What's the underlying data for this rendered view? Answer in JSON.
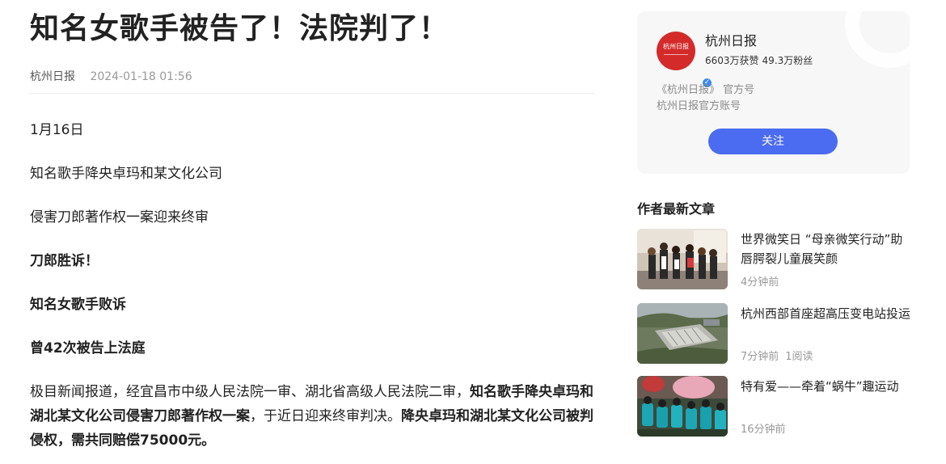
{
  "article": {
    "title": "知名女歌手被告了！法院判了！",
    "source": "杭州日报",
    "time": "2024-01-18 01:56",
    "paragraphs": [
      "1月16日",
      "知名歌手降央卓玛和某文化公司",
      "侵害刀郎著作权一案迎来终审",
      "刀郎胜诉！",
      "知名女歌手败诉",
      "曾42次被告上法庭"
    ],
    "last_paragraph": {
      "part1": "极目新闻报道，经宜昌市中级人民法院一审、湖北省高级人民法院二审，",
      "part2_bold": "知名歌手降央卓玛和湖北某文化公司侵害刀郎著作权一案",
      "part3": "，于近日迎来终审判决。",
      "part4_bold": "降央卓玛和湖北某文化公司被判侵权，需共同赔偿75000元。"
    }
  },
  "author": {
    "avatar_text": "杭州日报",
    "name": "杭州日报",
    "likes": "6603万获赞",
    "fans": "49.3万粉丝",
    "official_line1": "《杭州日报》 官方号",
    "official_line2": "杭州日报官方账号",
    "follow_label": "关注",
    "verified_mark": "✓"
  },
  "latest": {
    "heading": "作者最新文章",
    "items": [
      {
        "title": "世界微笑日 “母亲微笑行动”助唇腭裂儿童展笑颜",
        "time": "4分钟前",
        "reads": ""
      },
      {
        "title": "杭州西部首座超高压变电站投运",
        "time": "7分钟前",
        "reads": "1阅读"
      },
      {
        "title": "特有爱——牵着“蜗牛”趣运动",
        "time": "16分钟前",
        "reads": ""
      }
    ]
  },
  "colors": {
    "accent": "#4b6cf0",
    "avatar_red": "#d42a2a",
    "verified_blue": "#3a8bf0"
  }
}
